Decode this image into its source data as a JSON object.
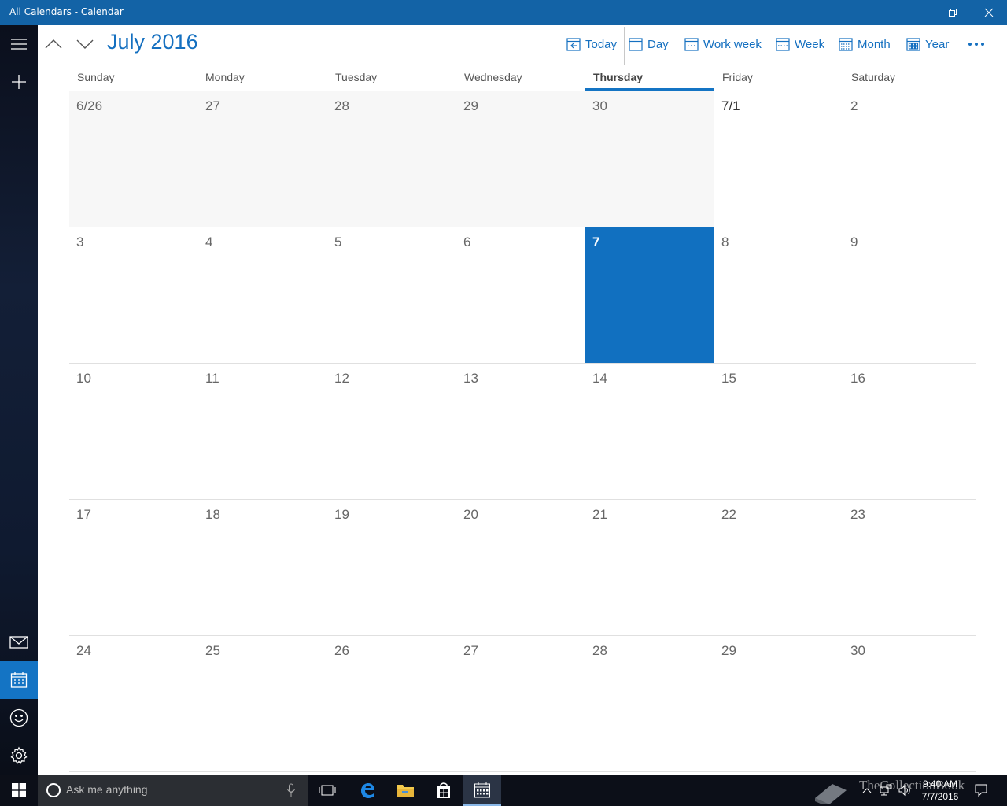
{
  "window": {
    "title": "All Calendars - Calendar",
    "minimize_icon": "minimize-icon",
    "restore_icon": "restore-icon",
    "close_icon": "close-icon"
  },
  "rail": {
    "menu_icon": "hamburger-menu-icon",
    "new_event_icon": "plus-icon",
    "mail_icon": "mail-icon",
    "calendar_icon": "calendar-icon",
    "people_icon": "smiley-icon",
    "settings_icon": "gear-icon"
  },
  "header": {
    "month_title": "July 2016",
    "prev_icon": "chevron-up-icon",
    "next_icon": "chevron-down-icon"
  },
  "toolbar": {
    "today": "Today",
    "day": "Day",
    "work_week": "Work week",
    "week": "Week",
    "month": "Month",
    "year": "Year",
    "more_icon": "more-ellipsis-icon"
  },
  "weekdays": [
    "Sunday",
    "Monday",
    "Tuesday",
    "Wednesday",
    "Thursday",
    "Friday",
    "Saturday"
  ],
  "today_weekday_index": 4,
  "weeks": [
    [
      {
        "label": "6/26",
        "other": true
      },
      {
        "label": "27",
        "other": true
      },
      {
        "label": "28",
        "other": true
      },
      {
        "label": "29",
        "other": true
      },
      {
        "label": "30",
        "other": true
      },
      {
        "label": "7/1",
        "first": true
      },
      {
        "label": "2"
      }
    ],
    [
      {
        "label": "3"
      },
      {
        "label": "4"
      },
      {
        "label": "5"
      },
      {
        "label": "6"
      },
      {
        "label": "7",
        "current": true
      },
      {
        "label": "8"
      },
      {
        "label": "9"
      }
    ],
    [
      {
        "label": "10"
      },
      {
        "label": "11"
      },
      {
        "label": "12"
      },
      {
        "label": "13"
      },
      {
        "label": "14"
      },
      {
        "label": "15"
      },
      {
        "label": "16"
      }
    ],
    [
      {
        "label": "17"
      },
      {
        "label": "18"
      },
      {
        "label": "19"
      },
      {
        "label": "20"
      },
      {
        "label": "21"
      },
      {
        "label": "22"
      },
      {
        "label": "23"
      }
    ],
    [
      {
        "label": "24"
      },
      {
        "label": "25"
      },
      {
        "label": "26"
      },
      {
        "label": "27"
      },
      {
        "label": "28"
      },
      {
        "label": "29"
      },
      {
        "label": "30"
      }
    ]
  ],
  "taskbar": {
    "start_icon": "windows-start-icon",
    "search_placeholder": "Ask me anything",
    "cortana_icon": "cortana-circle-icon",
    "mic_icon": "microphone-icon",
    "task_view_icon": "task-view-icon",
    "edge_icon": "edge-browser-icon",
    "explorer_icon": "file-explorer-icon",
    "store_icon": "store-icon",
    "calendar_app_icon": "calendar-app-icon",
    "tray_chevron_icon": "chevron-up-icon",
    "network_icon": "network-icon",
    "volume_icon": "volume-icon",
    "notification_icon": "action-center-icon",
    "time": "9:40 AM",
    "date": "7/7/2016"
  },
  "watermark": "TheCollectionBook",
  "colors": {
    "accent": "#1570c0",
    "titlebar": "#1363a6",
    "selected_day": "#1170c0",
    "taskbar": "#0c0f18"
  }
}
